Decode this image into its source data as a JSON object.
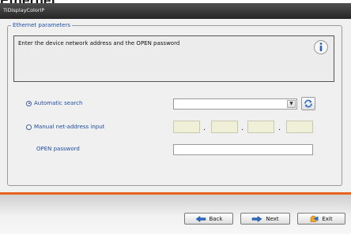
{
  "page_heading": "Ethernet",
  "window": {
    "title": "TiDisplayColorIP"
  },
  "group": {
    "legend": "Ethernet parameters"
  },
  "info": {
    "text": "Enter the device network address and the OPEN password",
    "icon": "info-icon"
  },
  "options": {
    "automatic": {
      "label": "Automatic search",
      "checked": true
    },
    "manual": {
      "label": "Manual net-address input",
      "checked": false
    }
  },
  "auto_search": {
    "selected": ""
  },
  "ip_octets": [
    "",
    "",
    "",
    ""
  ],
  "password": {
    "label": "OPEN password",
    "value": ""
  },
  "buttons": {
    "back": {
      "label": "Back",
      "icon": "arrow-left-icon"
    },
    "next": {
      "label": "Next",
      "icon": "arrow-right-icon"
    },
    "exit": {
      "label": "Exit",
      "icon": "exit-icon"
    }
  },
  "colors": {
    "accent_orange": "#e8641e",
    "label_blue": "#1f4fa8",
    "titlebar": "#333333"
  }
}
